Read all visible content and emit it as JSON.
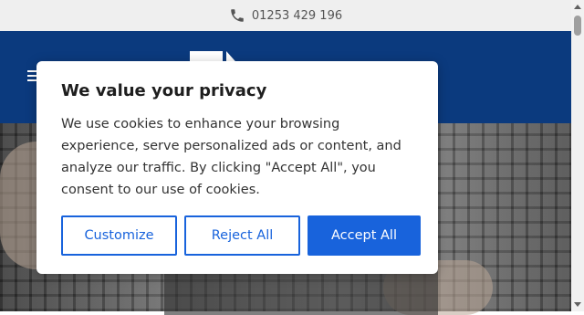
{
  "topbar": {
    "phone": "01253 429 196",
    "icon": "phone-icon"
  },
  "header": {
    "menu_icon": "hamburger-icon",
    "logo_icon": "logo-icon",
    "background": "#0b3a7e"
  },
  "cookie_banner": {
    "title": "We value your privacy",
    "body": "We use cookies to enhance your browsing experience, serve personalized ads or content, and analyze our traffic. By clicking \"Accept All\", you consent to our use of cookies.",
    "customize_label": "Customize",
    "reject_label": "Reject All",
    "accept_label": "Accept All",
    "accent_color": "#1863dc"
  }
}
